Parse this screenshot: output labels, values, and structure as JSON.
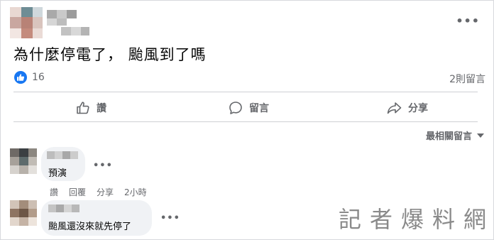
{
  "post": {
    "text": "為什麼停電了， 颱風到了嗎",
    "more_icon": "•••",
    "reaction_count": "16",
    "comment_count": "2則留言"
  },
  "actions": {
    "like": "讚",
    "comment": "留言",
    "share": "分享"
  },
  "sort": {
    "label": "最相關留言"
  },
  "comments": [
    {
      "text": "預演",
      "more_icon": "•••",
      "meta": {
        "like": "讚",
        "reply": "回覆",
        "share": "分享",
        "time": "2小時"
      }
    },
    {
      "text": "颱風還沒來就先停了",
      "more_icon": "•••"
    }
  ],
  "watermark": "記者爆料網",
  "colors": {
    "accent": "#1877f2",
    "muted": "#65676b",
    "bubble": "#f0f2f5"
  }
}
